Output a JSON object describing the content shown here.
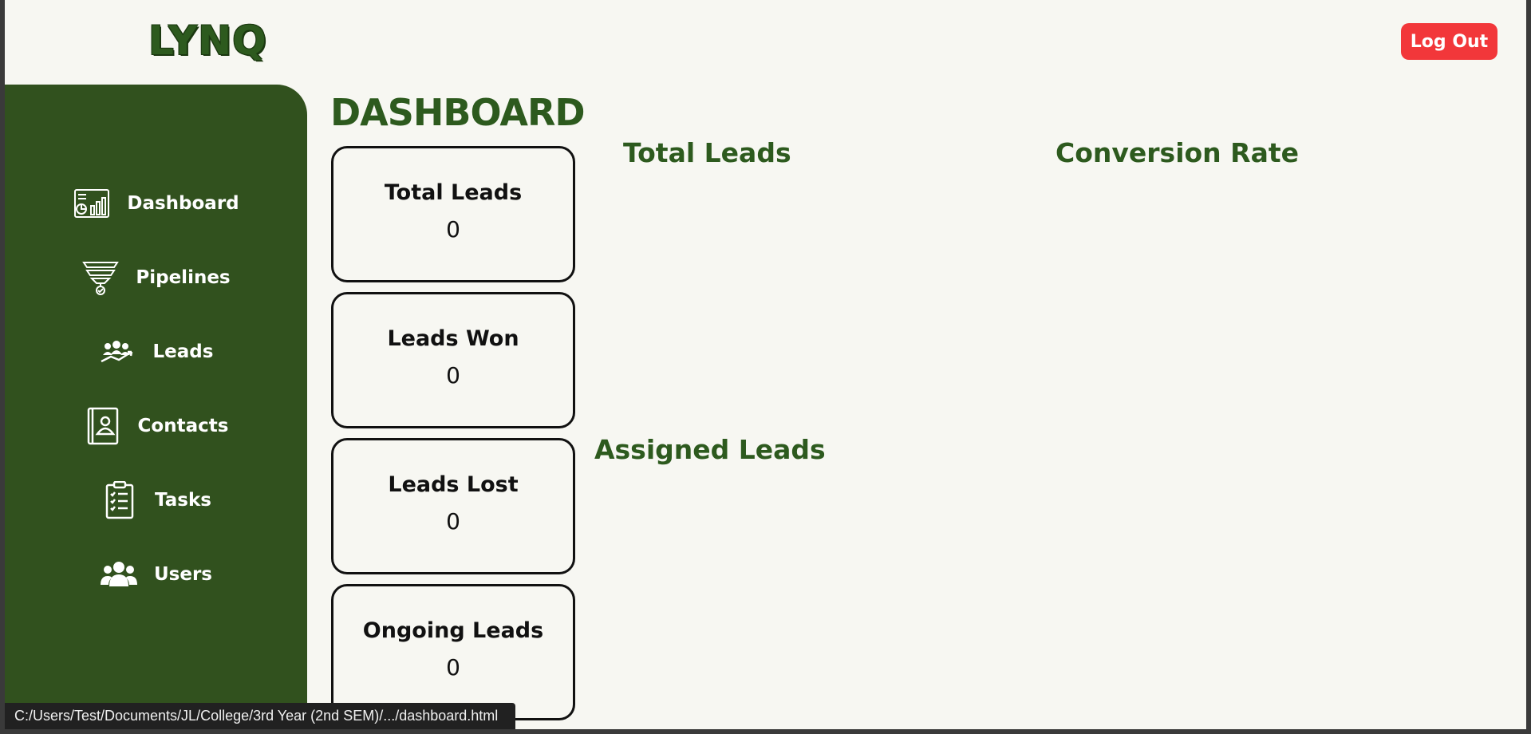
{
  "app": {
    "logo": "LYNQ",
    "logout_label": "Log Out"
  },
  "sidebar": {
    "items": [
      {
        "label": "Dashboard",
        "icon": "dashboard-icon"
      },
      {
        "label": "Pipelines",
        "icon": "funnel-icon"
      },
      {
        "label": "Leads",
        "icon": "leads-icon"
      },
      {
        "label": "Contacts",
        "icon": "contact-book-icon"
      },
      {
        "label": "Tasks",
        "icon": "clipboard-icon"
      },
      {
        "label": "Users",
        "icon": "users-icon"
      }
    ]
  },
  "main": {
    "title": "DASHBOARD",
    "cards": [
      {
        "title": "Total Leads",
        "value": "0"
      },
      {
        "title": "Leads Won",
        "value": "0"
      },
      {
        "title": "Leads Lost",
        "value": "0"
      },
      {
        "title": "Ongoing Leads",
        "value": "0"
      }
    ],
    "sections": {
      "total_leads": "Total Leads",
      "conversion_rate": "Conversion Rate",
      "assigned_leads": "Assigned Leads"
    }
  },
  "statusbar": {
    "url": "C:/Users/Test/Documents/JL/College/3rd Year (2nd SEM)/.../dashboard.html"
  },
  "colors": {
    "brand_green": "#31511e",
    "heading_green": "#2d5a1e",
    "logout_red": "#f2373a",
    "background": "#f7f7f2"
  }
}
